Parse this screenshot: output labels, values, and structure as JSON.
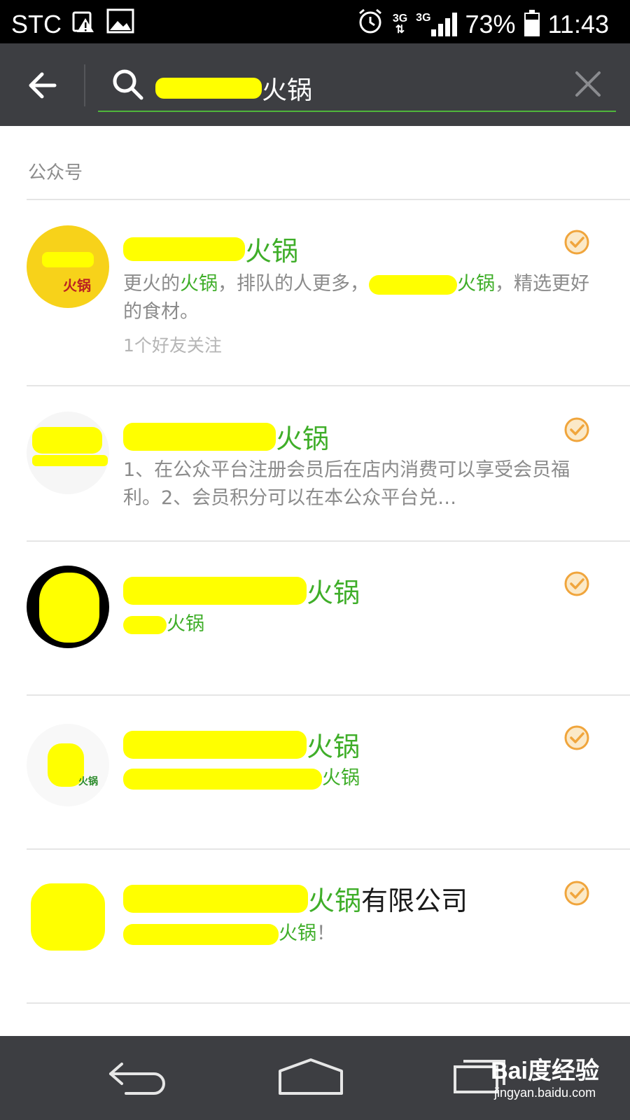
{
  "status_bar": {
    "carrier": "STC",
    "network_1": "3G",
    "network_2": "3G",
    "battery": "73%",
    "battery_level": 0.73,
    "time": "11:43",
    "icons": [
      "warning-icon",
      "image-icon",
      "alarm-icon",
      "signal-icon",
      "battery-icon"
    ]
  },
  "search": {
    "query_visible": "火锅",
    "back_icon": "back-arrow-icon",
    "search_icon": "search-icon",
    "clear_icon": "close-icon"
  },
  "section": {
    "label": "公众号"
  },
  "results": [
    {
      "title_suffix": "火锅",
      "desc_prefix": "更火的",
      "desc_hl_1": "火锅",
      "desc_mid": "，排队的人更多，",
      "desc_hl_2": "火锅",
      "desc_tail": "，精选更好的食材。",
      "meta": "1个好友关注",
      "verified": true
    },
    {
      "title_suffix": "火锅",
      "desc": "1、在公众平台注册会员后在店内消费可以享受会员福利。2、会员积分可以在本公众平台兑…",
      "verified": true
    },
    {
      "title_suffix": "火锅",
      "desc_hl": "火锅",
      "verified": true
    },
    {
      "title_suffix": "火锅",
      "desc_hl": "火锅",
      "verified": true
    },
    {
      "title_suffix_hl": "火锅",
      "title_suffix_plain": "有限公司",
      "desc_hl": "火锅",
      "desc_tail": "！",
      "verified": true
    }
  ],
  "nav": {
    "icons": [
      "back-nav-icon",
      "home-nav-icon",
      "recents-nav-icon"
    ]
  },
  "watermark": {
    "logo": "Bai度经验",
    "url": "jingyan.baidu.com"
  },
  "colors": {
    "accent_green": "#3fae29",
    "verified_orange": "#f0a53c",
    "toolbar": "#3d3e42"
  }
}
